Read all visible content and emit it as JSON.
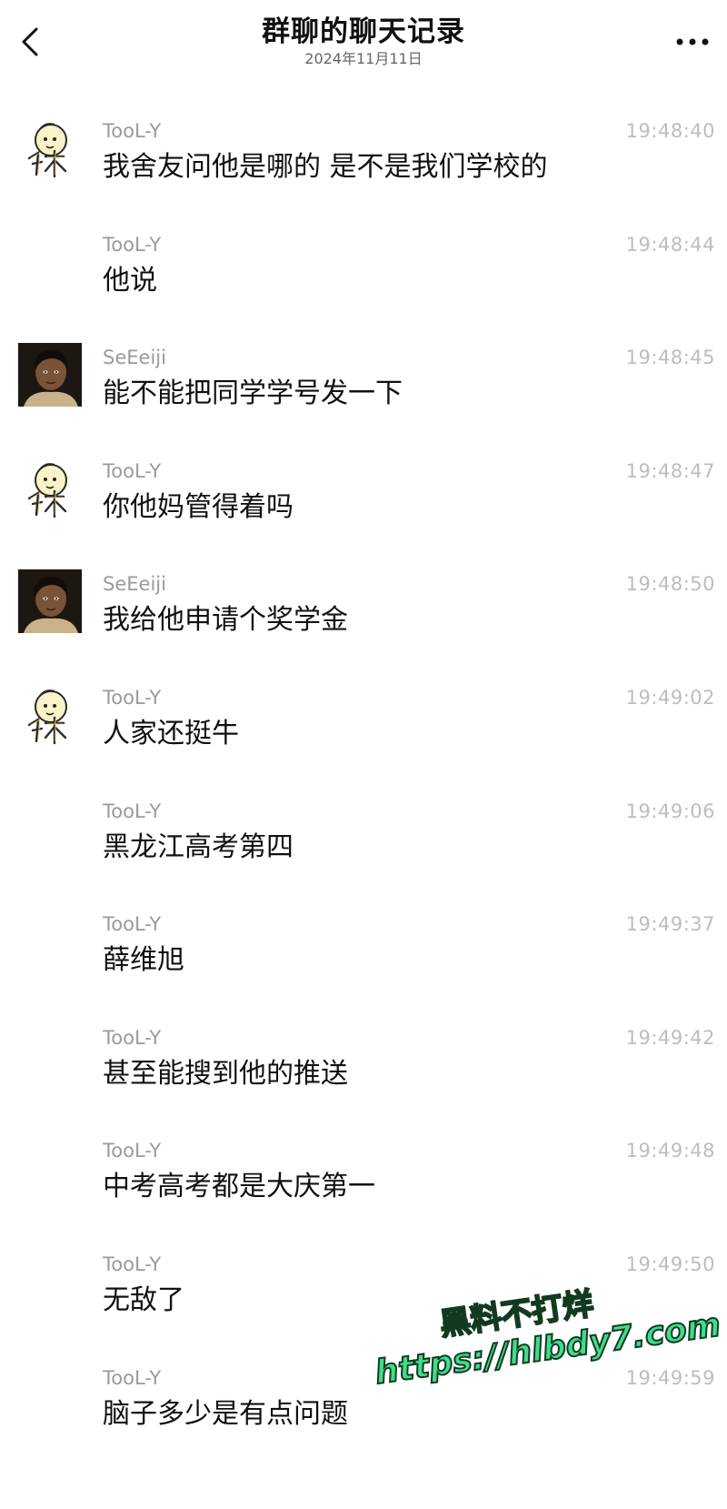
{
  "header": {
    "title": "群聊的聊天记录",
    "date": "2024年11月11日"
  },
  "messages": [
    {
      "sender": "TooL-Y",
      "time": "19:48:40",
      "text": "我舍友问他是哪的 是不是我们学校的",
      "avatar": "tool-y"
    },
    {
      "sender": "TooL-Y",
      "time": "19:48:44",
      "text": "他说",
      "avatar": ""
    },
    {
      "sender": "SeEeiji",
      "time": "19:48:45",
      "text": "能不能把同学学号发一下",
      "avatar": "seeeiji"
    },
    {
      "sender": "TooL-Y",
      "time": "19:48:47",
      "text": "你他妈管得着吗",
      "avatar": "tool-y"
    },
    {
      "sender": "SeEeiji",
      "time": "19:48:50",
      "text": "我给他申请个奖学金",
      "avatar": "seeeiji"
    },
    {
      "sender": "TooL-Y",
      "time": "19:49:02",
      "text": "人家还挺牛",
      "avatar": "tool-y"
    },
    {
      "sender": "TooL-Y",
      "time": "19:49:06",
      "text": "黑龙江高考第四",
      "avatar": ""
    },
    {
      "sender": "TooL-Y",
      "time": "19:49:37",
      "text": "薛维旭",
      "avatar": ""
    },
    {
      "sender": "TooL-Y",
      "time": "19:49:42",
      "text": "甚至能搜到他的推送",
      "avatar": ""
    },
    {
      "sender": "TooL-Y",
      "time": "19:49:48",
      "text": "中考高考都是大庆第一",
      "avatar": ""
    },
    {
      "sender": "TooL-Y",
      "time": "19:49:50",
      "text": "无敌了",
      "avatar": ""
    },
    {
      "sender": "TooL-Y",
      "time": "19:49:59",
      "text": "脑子多少是有点问题",
      "avatar": ""
    }
  ],
  "watermark": {
    "line1": "黑料不打烊",
    "line2": "https://hlbdy7.com"
  },
  "icons": {
    "back": "chevron-left-icon",
    "more": "more-dots-icon"
  },
  "colors": {
    "background": "#ffffff",
    "sender": "#9a9a9a",
    "time": "#bdbdbd",
    "watermark": "#3fdc8f"
  }
}
